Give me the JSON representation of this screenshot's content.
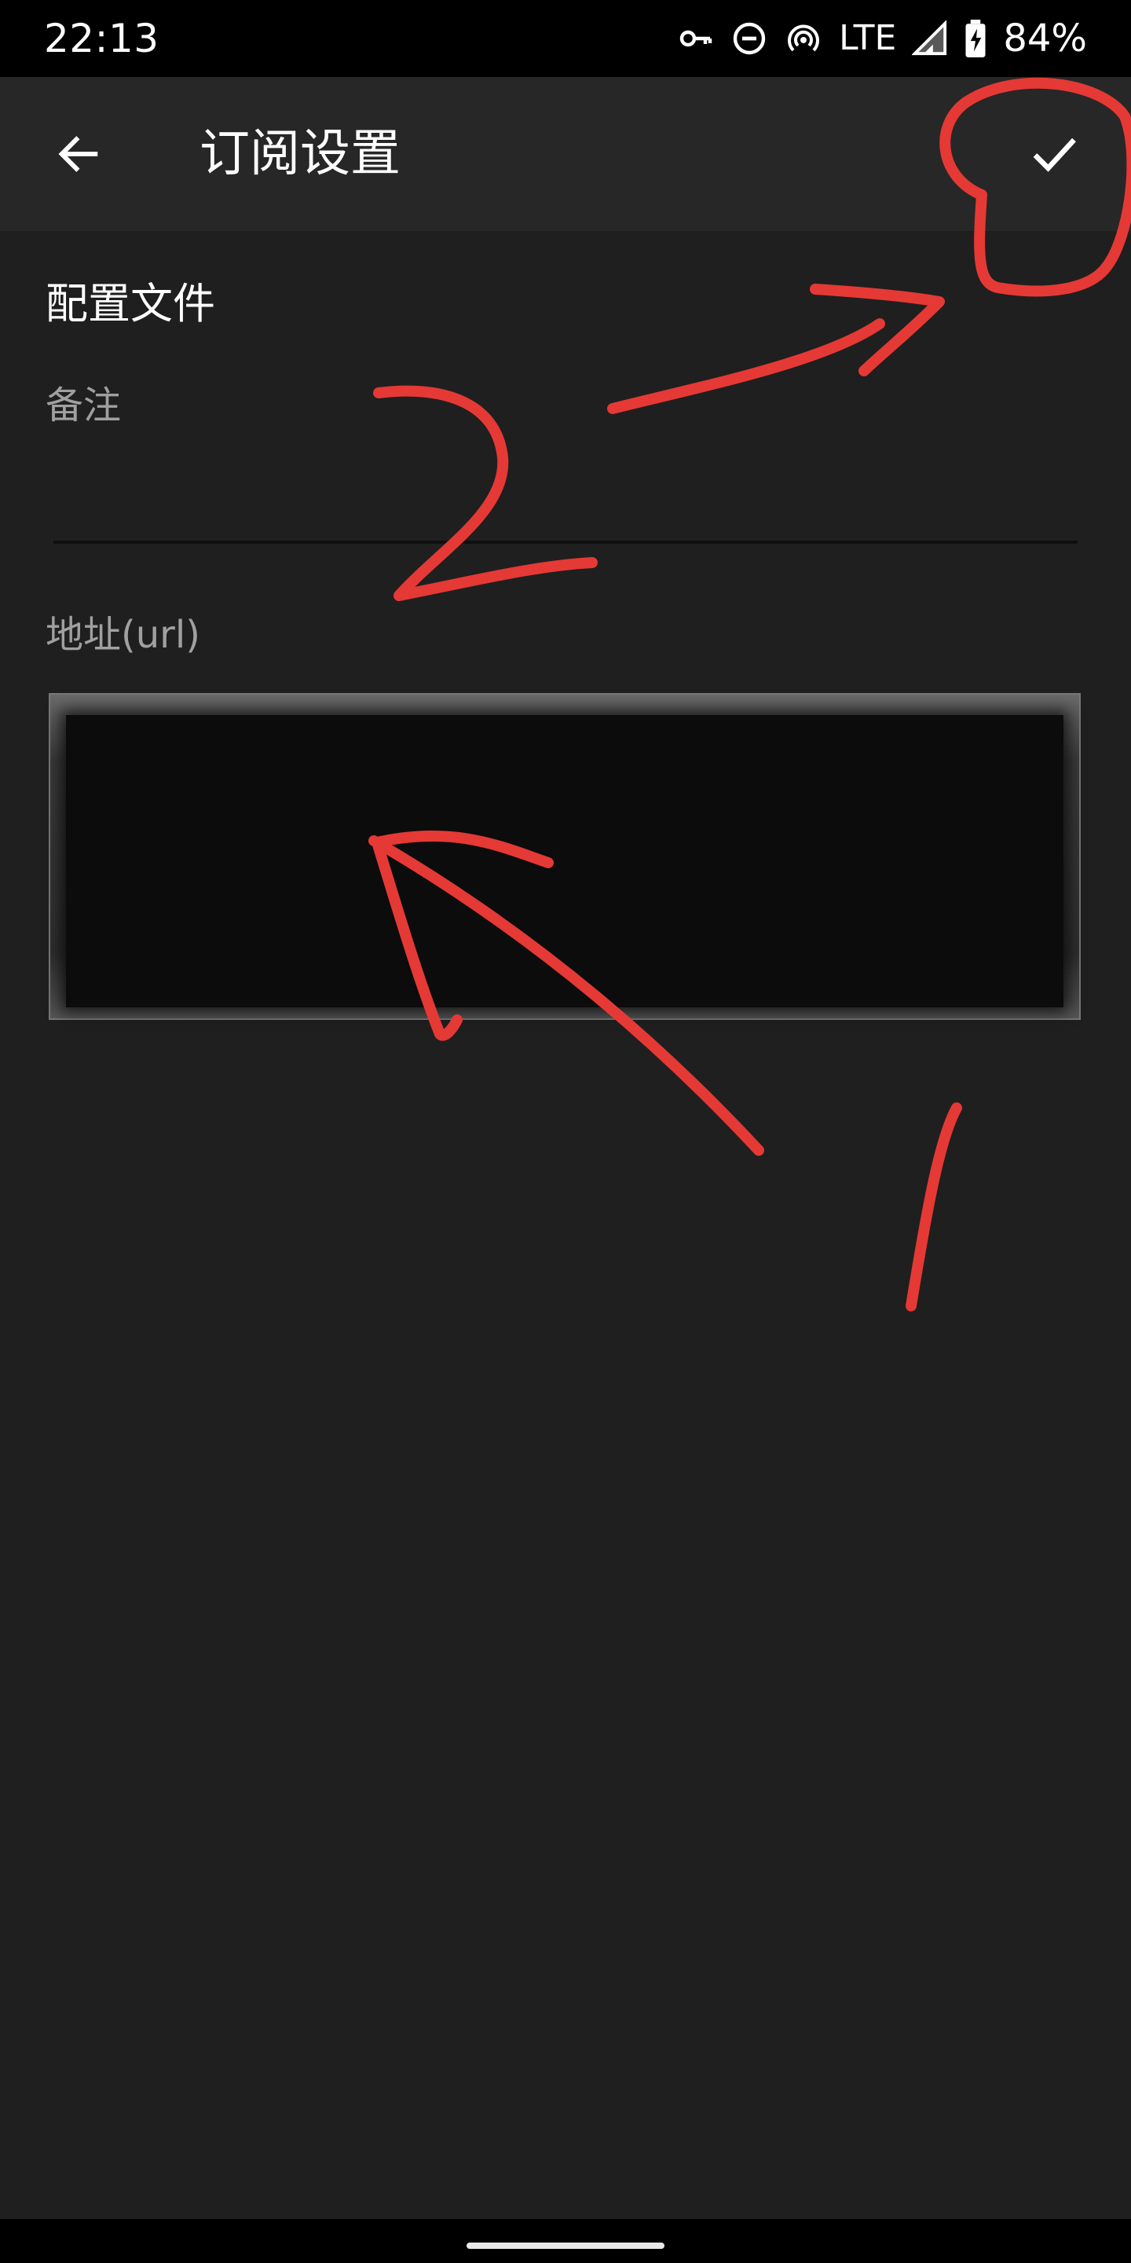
{
  "status_bar": {
    "time": "22:13",
    "network": "LTE",
    "battery": "84%",
    "icons": [
      "vpn-key-icon",
      "do-not-disturb-icon",
      "hotspot-icon",
      "signal-icon",
      "battery-charging-icon"
    ]
  },
  "app_bar": {
    "title": "订阅设置",
    "back_icon": "arrow-back-icon",
    "confirm_icon": "check-icon"
  },
  "form": {
    "section_title": "配置文件",
    "remark": {
      "label": "备注",
      "value": ""
    },
    "url": {
      "label": "地址(url)",
      "value": ""
    }
  },
  "annotations": {
    "color": "#e53935",
    "marks": [
      "1",
      "2"
    ]
  },
  "colors": {
    "background": "#1f1f1f",
    "app_bar": "#272727",
    "label": "#a0a0a0"
  }
}
